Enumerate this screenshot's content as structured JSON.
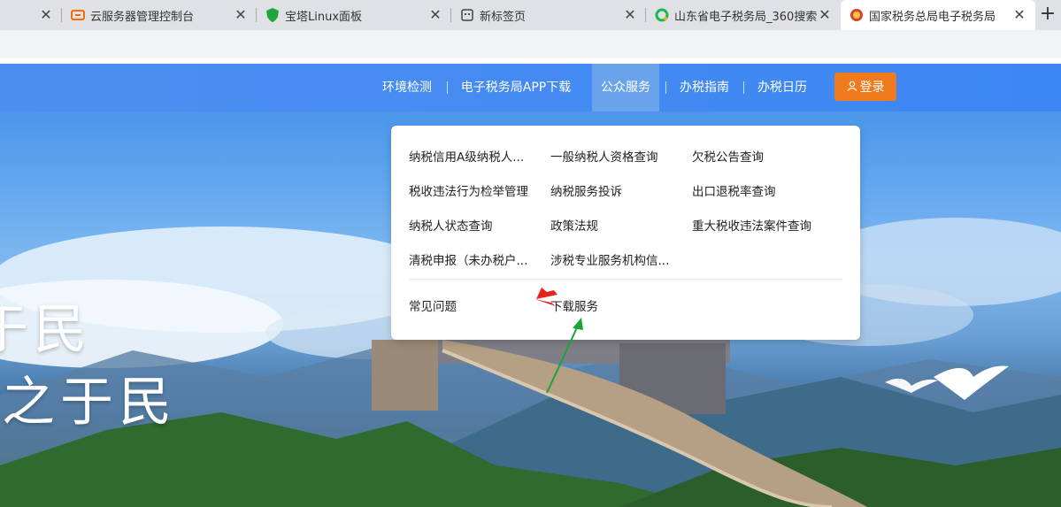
{
  "browser": {
    "tabs": [
      {
        "title": "云服务器管理控制台",
        "icon": "aliyun-icon"
      },
      {
        "title": "宝塔Linux面板",
        "icon": "bt-shield-icon"
      },
      {
        "title": "新标签页",
        "icon": "newtab-grid-icon"
      },
      {
        "title": "山东省电子税务局_360搜索",
        "icon": "search360-icon"
      },
      {
        "title": "国家税务总局电子税务局",
        "icon": "tax-emblem-icon",
        "active": true
      }
    ],
    "close_glyph": "✕",
    "new_tab_glyph": "+"
  },
  "nav": {
    "items": [
      "环境检测",
      "电子税务局APP下载",
      "公众服务",
      "办税指南",
      "办税日历"
    ],
    "active": "公众服务",
    "login_label": "登录",
    "login_icon": "user-icon"
  },
  "hero": {
    "slogan_line1": "于民",
    "slogan_line2": "用之于民"
  },
  "dropdown": {
    "items": [
      "纳税信用A级纳税人...",
      "一般纳税人资格查询",
      "欠税公告查询",
      "税收违法行为检举管理",
      "纳税服务投诉",
      "出口退税率查询",
      "纳税人状态查询",
      "政策法规",
      "重大税收违法案件查询",
      "清税申报（未办税户...",
      "涉税专业服务机构信..."
    ],
    "bottom_items": [
      "常见问题",
      "下载服务"
    ]
  },
  "colors": {
    "navbar": "#3c86f3",
    "login_button": "#f07a1e",
    "annotation_red": "#e8231c",
    "annotation_green": "#1aa33a"
  }
}
